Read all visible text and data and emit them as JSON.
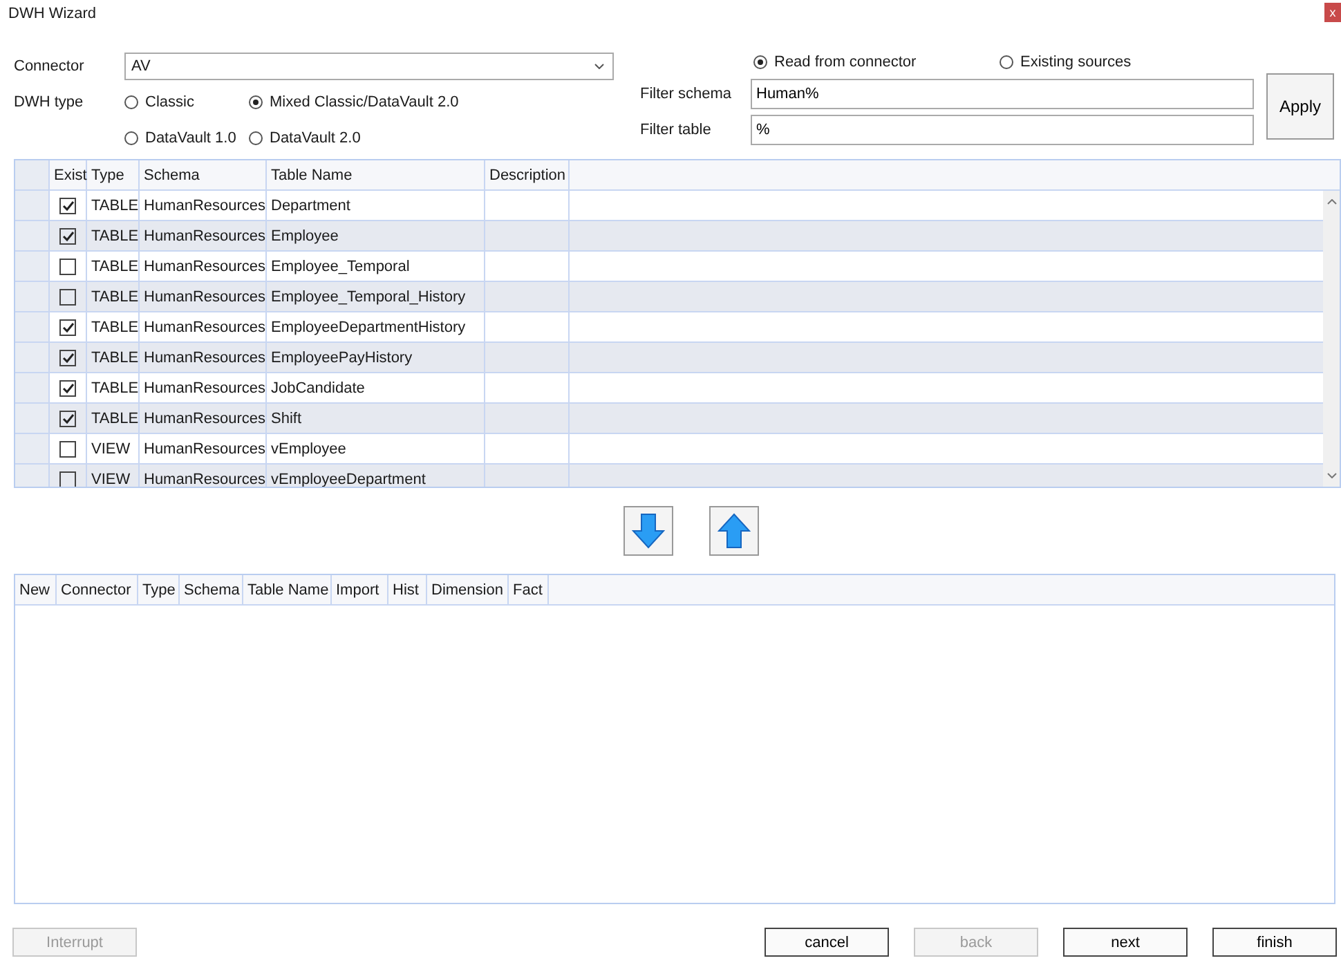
{
  "window": {
    "title": "DWH Wizard",
    "close": "x"
  },
  "connector": {
    "label": "Connector",
    "value": "AV"
  },
  "dwh_type": {
    "label": "DWH type",
    "options": [
      {
        "label": "Classic",
        "selected": false
      },
      {
        "label": "Mixed Classic/DataVault 2.0",
        "selected": true
      },
      {
        "label": "DataVault 1.0",
        "selected": false
      },
      {
        "label": "DataVault 2.0",
        "selected": false
      }
    ]
  },
  "source": [
    {
      "label": "Read from connector",
      "selected": true
    },
    {
      "label": "Existing sources",
      "selected": false
    }
  ],
  "filter_schema": {
    "label": "Filter schema",
    "value": "Human%"
  },
  "filter_table": {
    "label": "Filter table",
    "value": "%"
  },
  "apply_button": "Apply",
  "source_table": {
    "columns": [
      "Exist",
      "Type",
      "Schema",
      "Table Name",
      "Description"
    ],
    "rows": [
      {
        "checked": true,
        "type": "TABLE",
        "schema": "HumanResources",
        "name": "Department"
      },
      {
        "checked": true,
        "type": "TABLE",
        "schema": "HumanResources",
        "name": "Employee"
      },
      {
        "checked": false,
        "type": "TABLE",
        "schema": "HumanResources",
        "name": "Employee_Temporal"
      },
      {
        "checked": false,
        "type": "TABLE",
        "schema": "HumanResources",
        "name": "Employee_Temporal_History"
      },
      {
        "checked": true,
        "type": "TABLE",
        "schema": "HumanResources",
        "name": "EmployeeDepartmentHistory"
      },
      {
        "checked": true,
        "type": "TABLE",
        "schema": "HumanResources",
        "name": "EmployeePayHistory"
      },
      {
        "checked": true,
        "type": "TABLE",
        "schema": "HumanResources",
        "name": "JobCandidate"
      },
      {
        "checked": true,
        "type": "TABLE",
        "schema": "HumanResources",
        "name": "Shift"
      },
      {
        "checked": false,
        "type": "VIEW",
        "schema": "HumanResources",
        "name": "vEmployee"
      },
      {
        "checked": false,
        "type": "VIEW",
        "schema": "HumanResources",
        "name": "vEmployeeDepartment"
      }
    ]
  },
  "target_table": {
    "columns": [
      "New",
      "Connector",
      "Type",
      "Schema",
      "Table Name",
      "Import",
      "Hist",
      "Dimension",
      "Fact"
    ]
  },
  "buttons": [
    {
      "label": "Interrupt",
      "disabled": true
    },
    {
      "label": "cancel",
      "disabled": false
    },
    {
      "label": "back",
      "disabled": true
    },
    {
      "label": "next",
      "disabled": false
    },
    {
      "label": "finish",
      "disabled": false
    }
  ]
}
